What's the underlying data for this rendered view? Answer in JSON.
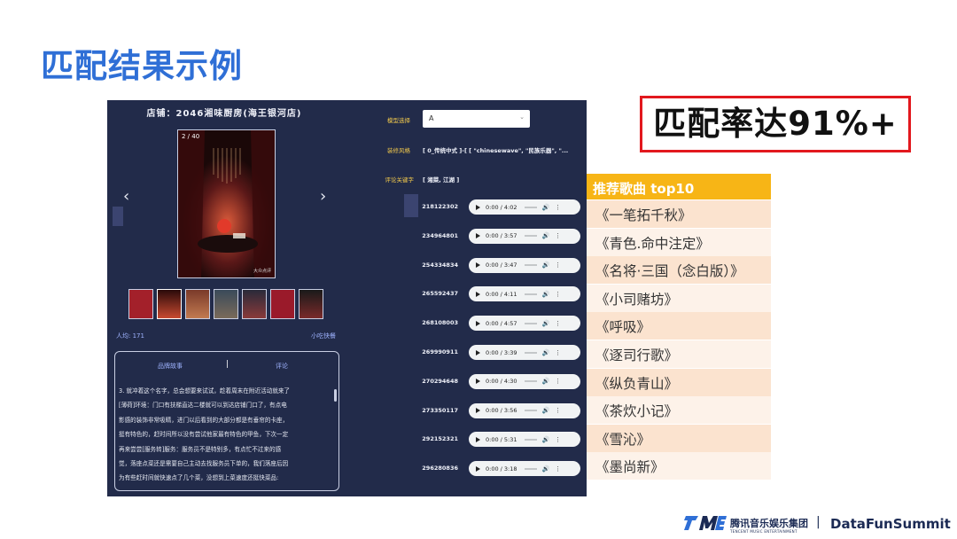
{
  "slide": {
    "title": "匹配结果示例",
    "badge": "匹配率达91%+"
  },
  "shop": {
    "title": "店铺：2046湘味厨房(海王银河店)",
    "gallery_counter": "2 / 40",
    "watermark": "大众点评",
    "prev_label": "‹",
    "next_label": "›",
    "price": "人均: 171",
    "category": "小吃快餐",
    "tab_story": "品牌故事",
    "tab_sep": "|",
    "tab_review": "评论",
    "review_lines": [
      "3. 就冲着这个名字，总会想要来试试，趁着周末在附近活动就来了",
      "[薄荷]环境：门口有扶梯直达二楼就可以到达店铺门口了，有点电",
      "影感的装饰非常吸睛，进门以后看到的大部分都是有垂帘的卡座，",
      "挺有特色的，赶时间所以没有尝试他家最有特色的甲鱼，下次一定",
      "再来尝尝[服务转]服务：服务员不是特别多，有点忙不过来的感",
      "觉，落座点菜还是需要自己主动去找服务员下单的，我们落座后因",
      "为有些赶时间就快速点了几个菜，没想到上菜速度还挺快菜品:"
    ]
  },
  "form": {
    "model_label": "模型选择",
    "model_value": "A",
    "style_label": "装修风格",
    "style_value": "[ 0_传统中式 ]-[ [ \"chinesewave\", \"民族乐器\", \"...",
    "keyword_label": "评论关键字",
    "keyword_value": "[ 湘菜, 江湖 ]"
  },
  "tracks": [
    {
      "id": "218122302",
      "time": "0:00 / 4:02"
    },
    {
      "id": "234964801",
      "time": "0:00 / 3:57"
    },
    {
      "id": "254334834",
      "time": "0:00 / 3:47"
    },
    {
      "id": "265592437",
      "time": "0:00 / 4:11"
    },
    {
      "id": "268108003",
      "time": "0:00 / 4:57"
    },
    {
      "id": "269990911",
      "time": "0:00 / 3:39"
    },
    {
      "id": "270294648",
      "time": "0:00 / 4:30"
    },
    {
      "id": "273350117",
      "time": "0:00 / 3:56"
    },
    {
      "id": "292152321",
      "time": "0:00 / 5:31"
    },
    {
      "id": "296280836",
      "time": "0:00 / 3:18"
    }
  ],
  "songs": {
    "header": "推荐歌曲 top10",
    "items": [
      "《一笔拓千秋》",
      "《青色.命中注定》",
      "《名将·三国（念白版）》",
      "《小司赌坊》",
      "《呼吸》",
      "《逐司行歌》",
      "《纵负青山》",
      "《茶炊小记》",
      "《雪沁》",
      "《墨尚新》"
    ]
  },
  "footer": {
    "group_cn": "腾讯音乐娱乐集团",
    "group_en": "TENCENT MUSIC ENTERTAINMENT",
    "sep": "|",
    "brand": "DataFunSummit"
  },
  "colors": {
    "title_blue": "#2f6fd6",
    "panel_bg": "#222b4a",
    "label_yellow": "#f2c94c",
    "song_header": "#f7b516",
    "badge_border": "#e2181e"
  }
}
